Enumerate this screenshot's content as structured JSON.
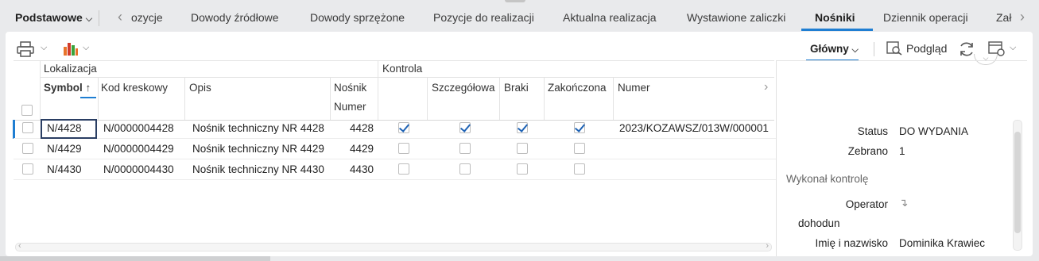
{
  "tabbar": {
    "dropdown_label": "Podstawowe",
    "tabs": [
      {
        "label": "ozycje"
      },
      {
        "label": "Dowody źródłowe"
      },
      {
        "label": "Dowody sprzężone"
      },
      {
        "label": "Pozycje do realizacji"
      },
      {
        "label": "Aktualna realizacja"
      },
      {
        "label": "Wystawione zaliczki"
      },
      {
        "label": "Nośniki"
      },
      {
        "label": "Dziennik operacji"
      },
      {
        "label": "Zał"
      }
    ],
    "active_tab": "Nośniki"
  },
  "toolbar": {
    "view_label": "Główny",
    "preview_label": "Podgląd"
  },
  "grid": {
    "group_headers": {
      "lokalizacja": "Lokalizacja",
      "kontrola": "Kontrola"
    },
    "columns": {
      "symbol": "Symbol",
      "kod": "Kod kreskowy",
      "opis": "Opis",
      "nosnik": "Nośnik",
      "numer_sub": "Numer",
      "szczegolowa": "Szczegółowa",
      "braki": "Braki",
      "zakonczona": "Zakończona",
      "numer": "Numer"
    },
    "rows": [
      {
        "symbol": "N/4428",
        "kod": "N/0000004428",
        "opis": "Nośnik techniczny NR 4428",
        "numer": "4428",
        "kontrola": true,
        "szczegolowa": true,
        "braki": true,
        "zakonczona": true,
        "dokument": "2023/KOZAWSZ/013W/000001"
      },
      {
        "symbol": "N/4429",
        "kod": "N/0000004429",
        "opis": "Nośnik techniczny NR 4429",
        "numer": "4429",
        "kontrola": false,
        "szczegolowa": false,
        "braki": false,
        "zakonczona": false,
        "dokument": ""
      },
      {
        "symbol": "N/4430",
        "kod": "N/0000004430",
        "opis": "Nośnik techniczny NR 4430",
        "numer": "4430",
        "kontrola": false,
        "szczegolowa": false,
        "braki": false,
        "zakonczona": false,
        "dokument": ""
      }
    ]
  },
  "detail": {
    "status_label": "Status",
    "status_value": "DO WYDANIA",
    "zebrano_label": "Zebrano",
    "zebrano_value": "1",
    "section_title": "Wykonał kontrolę",
    "operator_label": "Operator",
    "operator_value": "dohodun",
    "name_label": "Imię i nazwisko",
    "name_value": "Dominika Krawiec"
  },
  "colors": {
    "accent": "#1f7ed2",
    "check": "#1f63b5"
  }
}
